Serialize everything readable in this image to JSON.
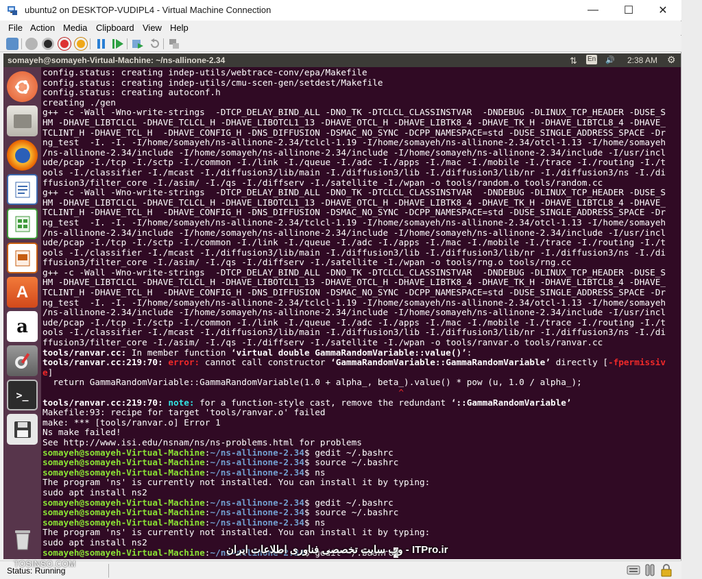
{
  "window": {
    "title": "ubuntu2 on DESKTOP-VUDIPL4 - Virtual Machine Connection",
    "minimize": "—",
    "maximize": "☐",
    "close": "✕"
  },
  "menu": [
    "File",
    "Action",
    "Media",
    "Clipboard",
    "View",
    "Help"
  ],
  "ubuntu_panel": {
    "title": "somayeh@somayeh-Virtual-Machine: ~/ns-allinone-2.34",
    "network": "⇅",
    "keyboard": "En",
    "volume": "🔊",
    "time": "2:38 AM",
    "gear": "⚙"
  },
  "launcher_icons": [
    "ubuntu-dash-icon",
    "files-icon",
    "firefox-icon",
    "writer-icon",
    "calc-icon",
    "impress-icon",
    "software-center-icon",
    "amazon-icon",
    "system-settings-icon",
    "terminal-icon",
    "floppy-icon",
    "trash-icon"
  ],
  "terminal": {
    "line_0": "config.status: creating indep-utils/webtrace-conv/epa/Makefile",
    "line_1": "config.status: creating indep-utils/cmu-scen-gen/setdest/Makefile",
    "line_2": "config.status: creating autoconf.h",
    "line_3": "creating ./gen",
    "line_4": "g++ -c -Wall -Wno-write-strings  -DTCP_DELAY_BIND_ALL -DNO_TK -DTCLCL_CLASSINSTVAR  -DNDEBUG -DLINUX_TCP_HEADER -DUSE_S",
    "line_5": "HM -DHAVE_LIBTCLCL -DHAVE_TCLCL_H -DHAVE_LIBOTCL1_13 -DHAVE_OTCL_H -DHAVE_LIBTK8_4 -DHAVE_TK_H -DHAVE_LIBTCL8_4 -DHAVE_",
    "line_6": "TCLINT_H -DHAVE_TCL_H  -DHAVE_CONFIG_H -DNS_DIFFUSION -DSMAC_NO_SYNC -DCPP_NAMESPACE=std -DUSE_SINGLE_ADDRESS_SPACE -Dr",
    "line_7": "ng_test  -I. -I. -I/home/somayeh/ns-allinone-2.34/tclcl-1.19 -I/home/somayeh/ns-allinone-2.34/otcl-1.13 -I/home/somayeh",
    "line_8": "/ns-allinone-2.34/include -I/home/somayeh/ns-allinone-2.34/include -I/home/somayeh/ns-allinone-2.34/include -I/usr/incl",
    "line_9": "ude/pcap -I./tcp -I./sctp -I./common -I./link -I./queue -I./adc -I./apps -I./mac -I./mobile -I./trace -I./routing -I./t",
    "line_10": "ools -I./classifier -I./mcast -I./diffusion3/lib/main -I./diffusion3/lib -I./diffusion3/lib/nr -I./diffusion3/ns -I./di",
    "line_11": "ffusion3/filter_core -I./asim/ -I./qs -I./diffserv -I./satellite -I./wpan -o tools/random.o tools/random.cc",
    "line_12": "g++ -c -Wall -Wno-write-strings  -DTCP_DELAY_BIND_ALL -DNO_TK -DTCLCL_CLASSINSTVAR  -DNDEBUG -DLINUX_TCP_HEADER -DUSE_S",
    "line_13": "HM -DHAVE_LIBTCLCL -DHAVE_TCLCL_H -DHAVE_LIBOTCL1_13 -DHAVE_OTCL_H -DHAVE_LIBTK8_4 -DHAVE_TK_H -DHAVE_LIBTCL8_4 -DHAVE_",
    "line_14": "TCLINT_H -DHAVE_TCL_H  -DHAVE_CONFIG_H -DNS_DIFFUSION -DSMAC_NO_SYNC -DCPP_NAMESPACE=std -DUSE_SINGLE_ADDRESS_SPACE -Dr",
    "line_15": "ng_test  -I. -I. -I/home/somayeh/ns-allinone-2.34/tclcl-1.19 -I/home/somayeh/ns-allinone-2.34/otcl-1.13 -I/home/somayeh",
    "line_16": "/ns-allinone-2.34/include -I/home/somayeh/ns-allinone-2.34/include -I/home/somayeh/ns-allinone-2.34/include -I/usr/incl",
    "line_17": "ude/pcap -I./tcp -I./sctp -I./common -I./link -I./queue -I./adc -I./apps -I./mac -I./mobile -I./trace -I./routing -I./t",
    "line_18": "ools -I./classifier -I./mcast -I./diffusion3/lib/main -I./diffusion3/lib -I./diffusion3/lib/nr -I./diffusion3/ns -I./di",
    "line_19": "ffusion3/filter_core -I./asim/ -I./qs -I./diffserv -I./satellite -I./wpan -o tools/rng.o tools/rng.cc",
    "line_20": "g++ -c -Wall -Wno-write-strings  -DTCP_DELAY_BIND_ALL -DNO_TK -DTCLCL_CLASSINSTVAR  -DNDEBUG -DLINUX_TCP_HEADER -DUSE_S",
    "line_21": "HM -DHAVE_LIBTCLCL -DHAVE_TCLCL_H -DHAVE_LIBOTCL1_13 -DHAVE_OTCL_H -DHAVE_LIBTK8_4 -DHAVE_TK_H -DHAVE_LIBTCL8_4 -DHAVE_",
    "line_22": "TCLINT_H -DHAVE_TCL_H  -DHAVE_CONFIG_H -DNS_DIFFUSION -DSMAC_NO_SYNC -DCPP_NAMESPACE=std -DUSE_SINGLE_ADDRESS_SPACE -Dr",
    "line_23": "ng_test  -I. -I. -I/home/somayeh/ns-allinone-2.34/tclcl-1.19 -I/home/somayeh/ns-allinone-2.34/otcl-1.13 -I/home/somayeh",
    "line_24": "/ns-allinone-2.34/include -I/home/somayeh/ns-allinone-2.34/include -I/home/somayeh/ns-allinone-2.34/include -I/usr/incl",
    "line_25": "ude/pcap -I./tcp -I./sctp -I./common -I./link -I./queue -I./adc -I./apps -I./mac -I./mobile -I./trace -I./routing -I./t",
    "line_26": "ools -I./classifier -I./mcast -I./diffusion3/lib/main -I./diffusion3/lib -I./diffusion3/lib/nr -I./diffusion3/ns -I./di",
    "line_27": "ffusion3/filter_core -I./asim/ -I./qs -I./diffserv -I./satellite -I./wpan -o tools/ranvar.o tools/ranvar.cc",
    "l28_a": "tools/ranvar.cc:",
    "l28_b": " In member function ",
    "l28_c": "‘virtual double GammaRandomVariable::value()’",
    "l28_d": ":",
    "l29_a": "tools/ranvar.cc:219:70: ",
    "l29_b": "error: ",
    "l29_c": "cannot call constructor ",
    "l29_d": "‘GammaRandomVariable::GammaRandomVariable’",
    "l29_e": " directly [",
    "l29_f": "-fpermissiv",
    "l30_a": "e",
    "l30_b": "]",
    "line_31": "  return GammaRandomVariable::GammaRandomVariable(1.0 + alpha_, beta_).value() * pow (u, 1.0 / alpha_);",
    "line_32_pre": "                                                                    ",
    "line_32_caret": "^",
    "l33_a": "tools/ranvar.cc:219:70: ",
    "l33_b": "note: ",
    "l33_c": "for a function-style cast, remove the redundant ",
    "l33_d": "‘::GammaRandomVariable’",
    "line_34": "Makefile:93: recipe for target 'tools/ranvar.o' failed",
    "line_35": "make: *** [tools/ranvar.o] Error 1",
    "line_36": "Ns make failed!",
    "line_37": "See http://www.isi.edu/nsnam/ns/ns-problems.html for problems",
    "prompt_user": "somayeh@somayeh-Virtual-Machine",
    "prompt_colon": ":",
    "prompt_path": "~/ns-allinone-2.34",
    "prompt_dollar": "$ ",
    "cmd_1": "gedit ~/.bashrc",
    "cmd_2": "source ~/.bashrc",
    "cmd_3": "ns",
    "line_41": "The program 'ns' is currently not installed. You can install it by typing:",
    "line_42": "sudo apt install ns2",
    "cmd_4": "gedit ~/.bashrc",
    "cmd_5": "source ~/.bashrc",
    "cmd_6": "ns",
    "line_46": "The program 'ns' is currently not installed. You can install it by typing:",
    "line_47": "sudo apt install ns2",
    "cmd_7": "gedit ~/.bashrc"
  },
  "status": {
    "text": "Status: Running"
  },
  "watermarks": {
    "site": "TOSINSO.COM",
    "itpro": "وب سایت تخصصی فناوری اطلاعات ایران - ITPro.ir"
  }
}
